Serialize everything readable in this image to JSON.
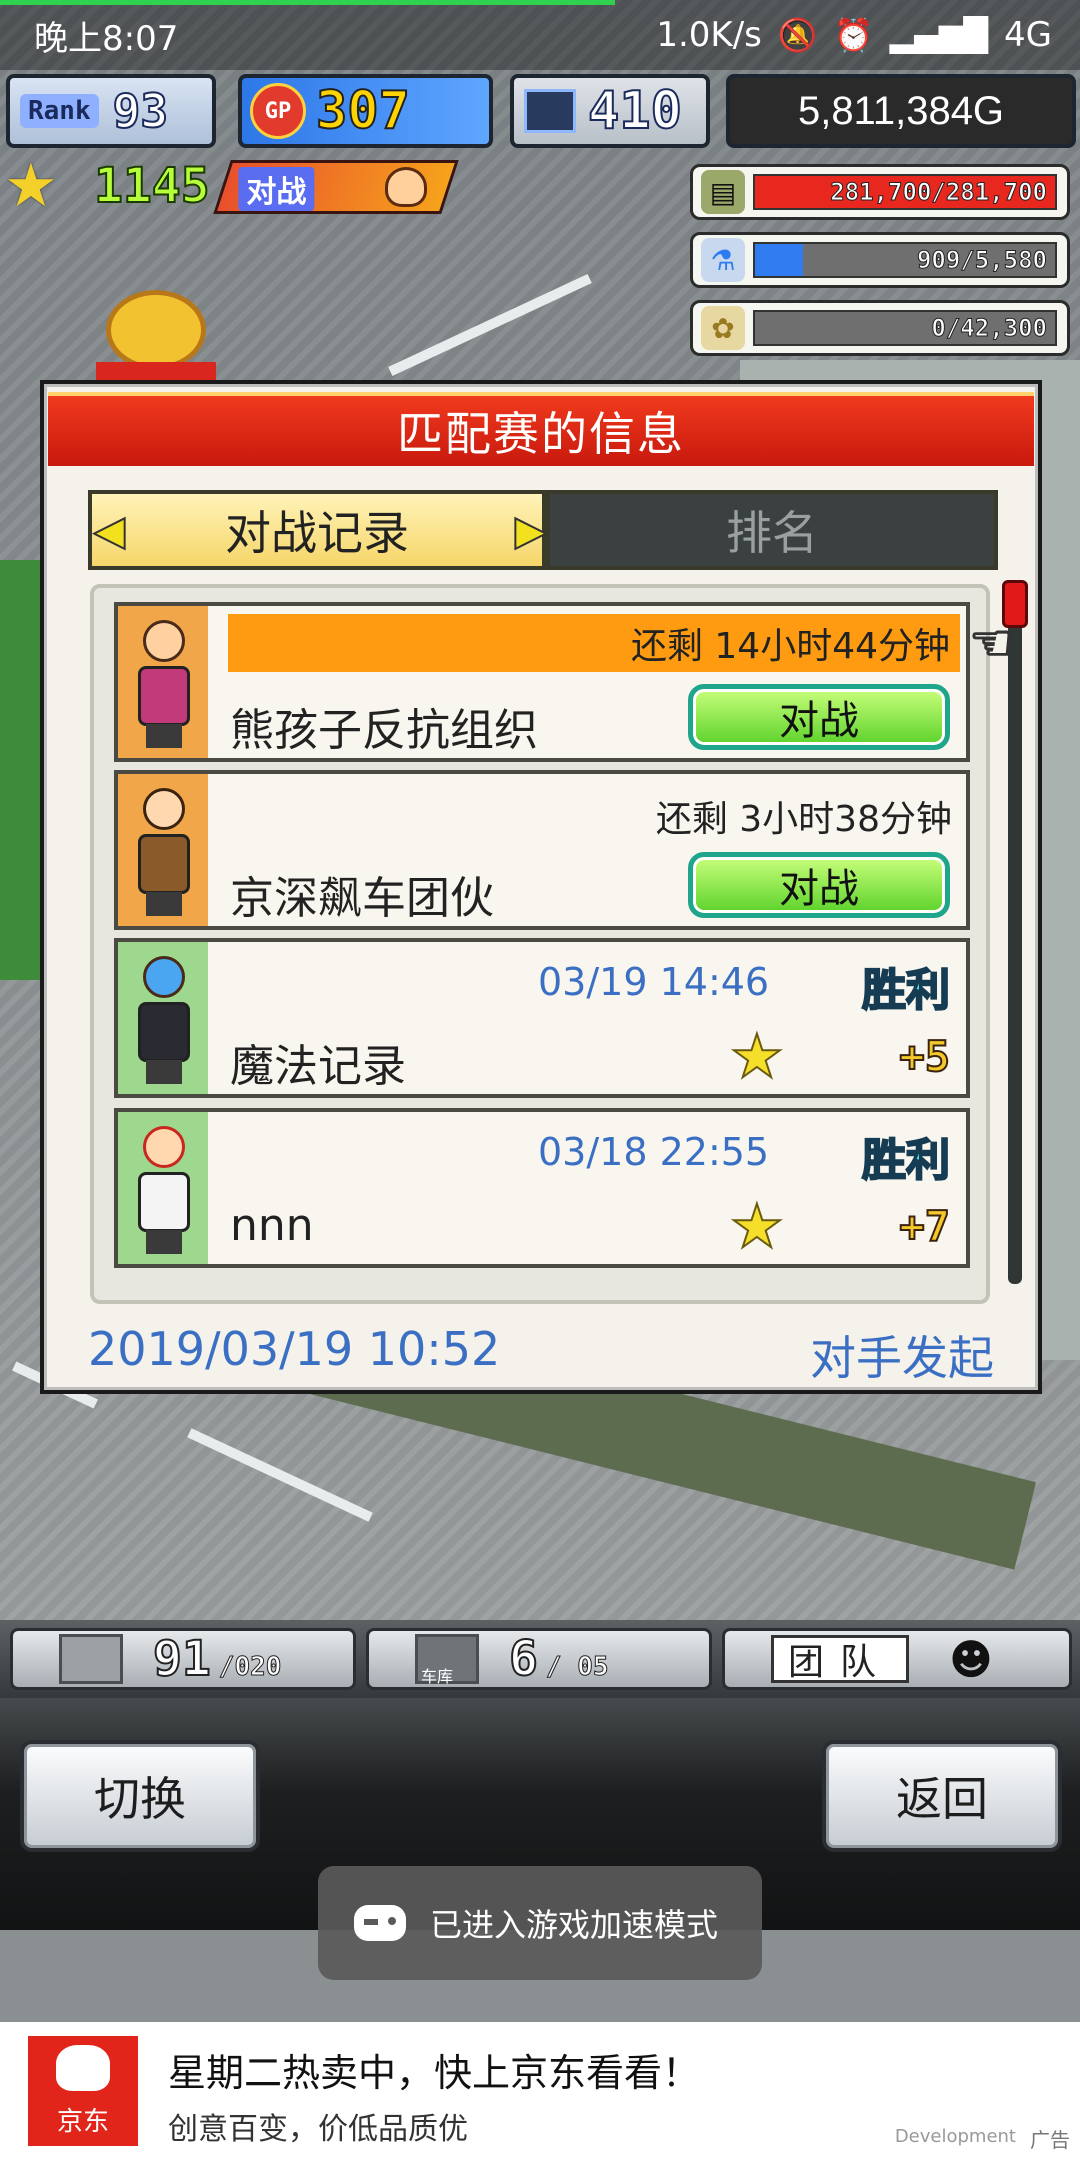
{
  "status_bar": {
    "time": "晚上8:07",
    "net_speed": "1.0K/s",
    "network": "4G"
  },
  "hud": {
    "rank_label": "Rank",
    "rank_value": "93",
    "gp_label": "GP",
    "gp_value": "307",
    "pc_value": "410",
    "money": "5,811,384G",
    "star_count": "1145",
    "battle_tag": "对战",
    "resources": [
      {
        "icon": "coins-icon",
        "text": "281,700/281,700",
        "fraction": 1.0,
        "color": "#e8271f"
      },
      {
        "icon": "potion-icon",
        "text": "909/5,580",
        "fraction": 0.16,
        "color": "#2f7bf0"
      },
      {
        "icon": "wheat-icon",
        "text": "0/42,300",
        "fraction": 0.0,
        "color": "#3aa0e8"
      }
    ]
  },
  "modal": {
    "title": "匹配赛的信息",
    "tabs": [
      "对战记录",
      "排名"
    ],
    "entries": [
      {
        "type": "pending",
        "remaining": "还剩 14小时44分钟",
        "name": "熊孩子反抗组织",
        "button": "对战"
      },
      {
        "type": "pending",
        "remaining": "还剩 3小时38分钟",
        "name": "京深飙车团伙",
        "button": "对战"
      },
      {
        "type": "done",
        "date": "03/19 14:46",
        "result": "胜利",
        "name": "魔法记录",
        "points": "+5"
      },
      {
        "type": "done",
        "date": "03/18 22:55",
        "result": "胜利",
        "name": "nnn",
        "points": "+7"
      }
    ],
    "footer_date": "2019/03/19 10:52",
    "footer_info": "对手发起"
  },
  "bottom_hud": {
    "storage_value": "91",
    "storage_max": "/020",
    "garage_label": "车库",
    "garage_value": "6",
    "garage_max": "/ 05",
    "team_label": "团队"
  },
  "buttons": {
    "switch": "切换",
    "back": "返回"
  },
  "toast": {
    "text": "已进入游戏加速模式"
  },
  "ad": {
    "brand": "京东",
    "title": "星期二热卖中，快上京东看看！",
    "subtitle": "创意百变，价低品质优",
    "dev": "Development",
    "tag": "广告"
  }
}
